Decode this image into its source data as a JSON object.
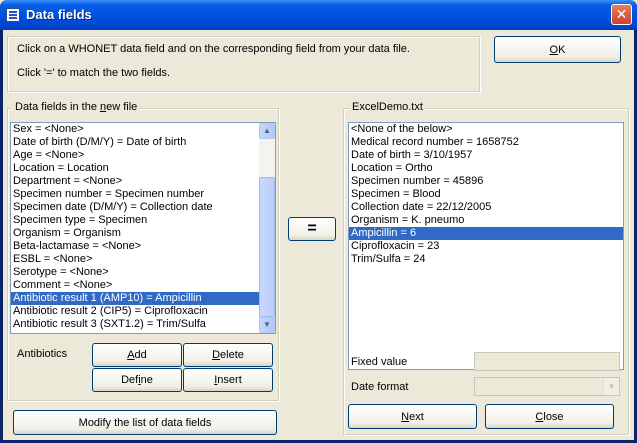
{
  "window": {
    "title": "Data fields",
    "close_glyph": "✕"
  },
  "instructions": {
    "line1": "Click on a WHONET data field and on the corresponding field from your data file.",
    "line2": "Click '=' to match the two fields."
  },
  "ok_button": {
    "label_pre": "",
    "label_u": "O",
    "label_post": "K"
  },
  "left_group": {
    "title_pre": "Data fields in the ",
    "title_u": "n",
    "title_post": "ew file",
    "items": [
      "Sex = <None>",
      "Date of birth (D/M/Y) = Date of birth",
      "Age = <None>",
      "Location = Location",
      "Department = <None>",
      "Specimen number = Specimen number",
      "Specimen date (D/M/Y) = Collection date",
      "Specimen type = Specimen",
      "Organism = Organism",
      "Beta-lactamase = <None>",
      "ESBL = <None>",
      "Serotype = <None>",
      "Comment = <None>",
      "Antibiotic result 1 (AMP10) = Ampicillin",
      "Antibiotic result 2 (CIP5) = Ciprofloxacin",
      "Antibiotic result 3 (SXT1.2) = Trim/Sulfa"
    ],
    "selected_index": 13
  },
  "antibiotics": {
    "label": "Antibiotics",
    "add": {
      "u": "A",
      "rest": "dd"
    },
    "delete": {
      "u": "D",
      "rest": "elete"
    },
    "define": {
      "pre": "Def",
      "u": "i",
      "rest": "ne"
    },
    "insert": {
      "u": "I",
      "rest": "nsert"
    }
  },
  "modify_button": "Modify the list of data fields",
  "equals_button": "=",
  "right_group": {
    "title": "ExcelDemo.txt",
    "items": [
      "<None of the below>",
      "Medical record number = 1658752",
      "Date of birth = 3/10/1957",
      "Location = Ortho",
      "Specimen number = 45896",
      "Specimen = Blood",
      "Collection date = 22/12/2005",
      "Organism = K. pneumo",
      "Ampicillin = 6",
      "Ciprofloxacin = 23",
      "Trim/Sulfa = 24"
    ],
    "selected_index": 8
  },
  "fixed_value": {
    "label": "Fixed value",
    "value": ""
  },
  "date_format": {
    "label": "Date format",
    "value": ""
  },
  "next_button": {
    "u": "N",
    "rest": "ext"
  },
  "close_button": {
    "pre": "",
    "u": "C",
    "rest": "lose"
  },
  "icons": {
    "scroll_up": "▲",
    "scroll_down": "▼",
    "dropdown": "▼"
  }
}
